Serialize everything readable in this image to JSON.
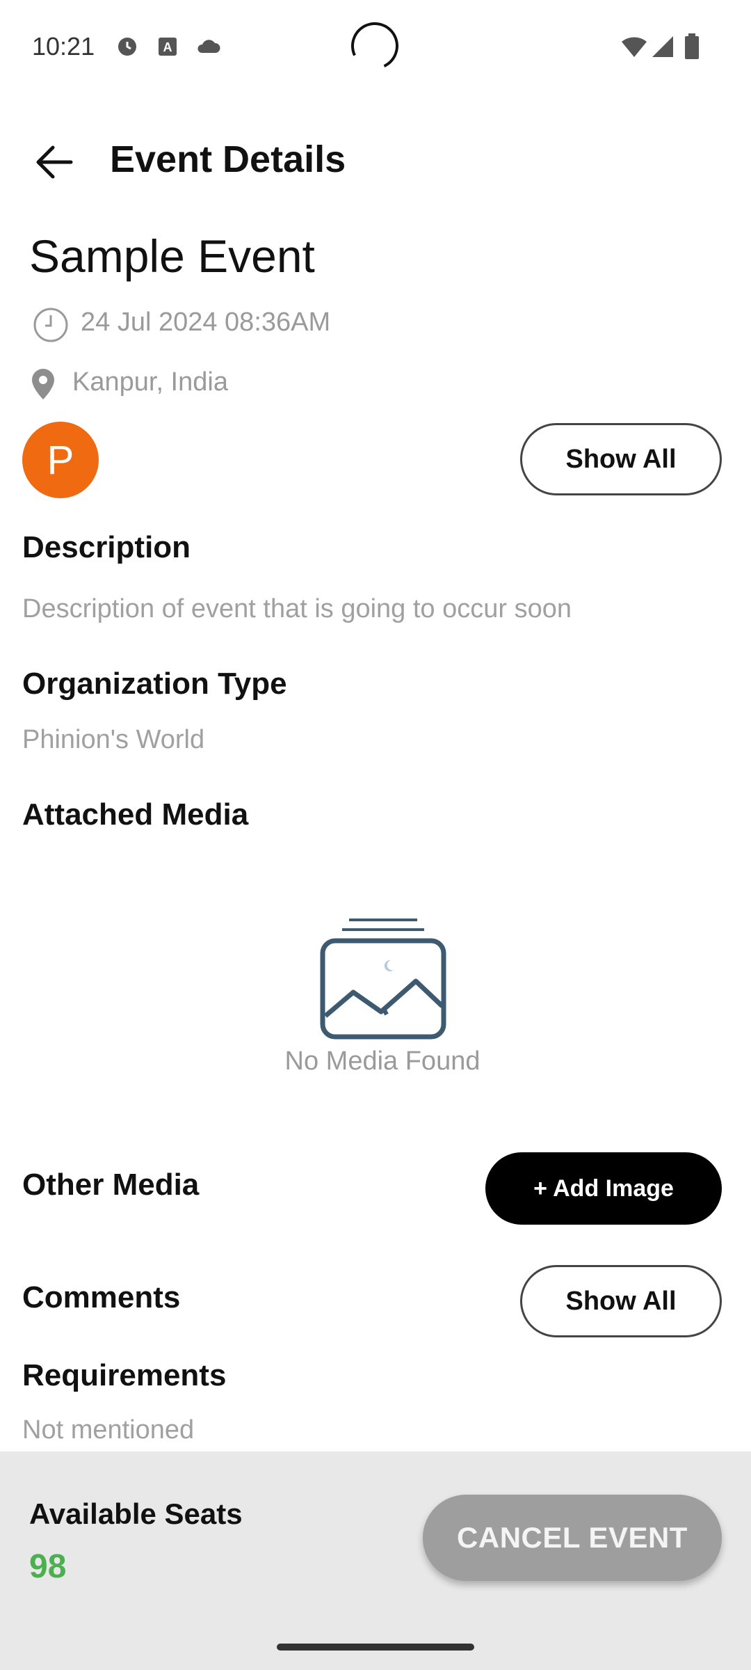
{
  "status_bar": {
    "time": "10:21"
  },
  "header": {
    "title": "Event Details"
  },
  "event": {
    "title": "Sample Event",
    "datetime": "24 Jul 2024 08:36AM",
    "location": "Kanpur, India",
    "avatar_letter": "P",
    "show_all_label": "Show All"
  },
  "sections": {
    "description_heading": "Description",
    "description_value": "Description of event that is going to occur soon",
    "org_type_heading": "Organization Type",
    "org_type_value": "Phinion's World",
    "attached_media_heading": "Attached Media",
    "no_media_text": "No Media Found",
    "other_media_heading": "Other Media",
    "add_image_label": "+ Add Image",
    "comments_heading": "Comments",
    "comments_show_all_label": "Show All",
    "requirements_heading": "Requirements",
    "requirements_value": "Not mentioned"
  },
  "bottom_bar": {
    "seats_label": "Available Seats",
    "seats_value": "98",
    "cancel_label": "CANCEL EVENT"
  },
  "colors": {
    "avatar": "#F06A12",
    "seats_value": "#4CAF50",
    "cancel_button": "#9E9E9E",
    "add_image_button": "#000000"
  },
  "icons": {
    "back": "arrow-left-icon",
    "date": "clock-icon",
    "location": "location-pin-icon",
    "media": "image-placeholder-icon"
  }
}
